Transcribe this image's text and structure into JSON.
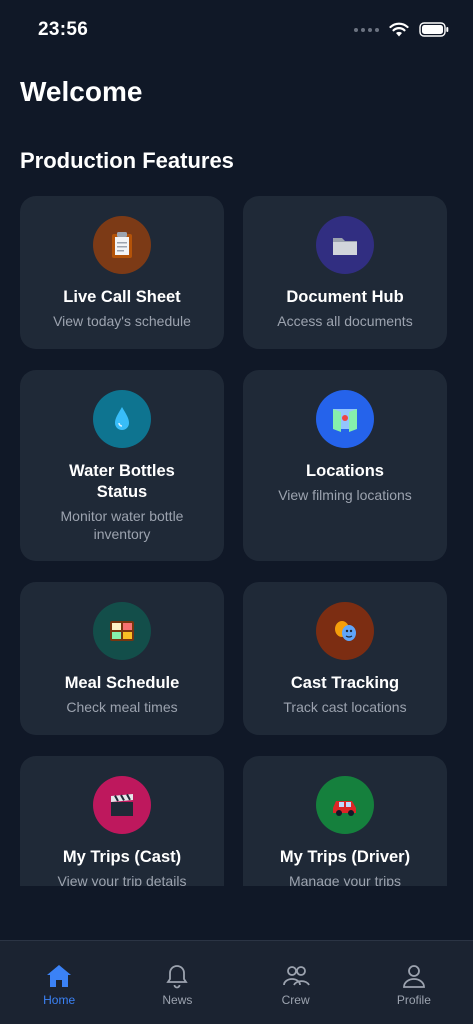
{
  "status_bar": {
    "time": "23:56"
  },
  "header": {
    "welcome": "Welcome",
    "section_title": "Production Features"
  },
  "features": [
    {
      "title": "Live Call Sheet",
      "desc": "View today's schedule",
      "icon": "clipboard-icon",
      "color": "#7c3a16"
    },
    {
      "title": "Document Hub",
      "desc": "Access all documents",
      "icon": "folder-icon",
      "color": "#312e81"
    },
    {
      "title": "Water Bottles Status",
      "desc": "Monitor water bottle inventory",
      "icon": "droplet-icon",
      "color": "#0e7490"
    },
    {
      "title": "Locations",
      "desc": "View filming locations",
      "icon": "map-icon",
      "color": "#2563eb"
    },
    {
      "title": "Meal Schedule",
      "desc": "Check meal times",
      "icon": "bento-icon",
      "color": "#134e4a"
    },
    {
      "title": "Cast Tracking",
      "desc": "Track cast locations",
      "icon": "theater-masks-icon",
      "color": "#7c2d12"
    },
    {
      "title": "My Trips (Cast)",
      "desc": "View your trip details",
      "icon": "clapperboard-icon",
      "color": "#be185d"
    },
    {
      "title": "My Trips (Driver)",
      "desc": "Manage your trips",
      "icon": "car-icon",
      "color": "#15803d"
    }
  ],
  "tabs": [
    {
      "label": "Home",
      "icon": "home-icon",
      "active": true
    },
    {
      "label": "News",
      "icon": "bell-icon",
      "active": false
    },
    {
      "label": "Crew",
      "icon": "people-icon",
      "active": false
    },
    {
      "label": "Profile",
      "icon": "person-icon",
      "active": false
    }
  ],
  "colors": {
    "background": "#101827",
    "card": "#1f2937",
    "accent": "#3b82f6",
    "muted": "#9ca3af"
  }
}
